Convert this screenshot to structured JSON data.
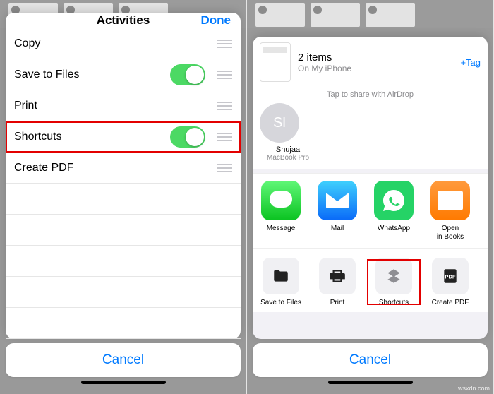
{
  "left": {
    "header_title": "Activities",
    "done_label": "Done",
    "cancel_label": "Cancel",
    "rows": [
      {
        "label": "Copy",
        "toggle": null
      },
      {
        "label": "Save to Files",
        "toggle": true
      },
      {
        "label": "Print",
        "toggle": null
      },
      {
        "label": "Shortcuts",
        "toggle": true,
        "highlight": true
      },
      {
        "label": "Create PDF",
        "toggle": null
      }
    ]
  },
  "right": {
    "item_title": "2 items",
    "item_subtitle": "On My iPhone",
    "tag_label": "+Tag",
    "airdrop_hint": "Tap to share with AirDrop",
    "airdrop_initials": "Sl",
    "airdrop_name": "Shujaa",
    "airdrop_device": "MacBook Pro",
    "apps": [
      {
        "label": "Message",
        "icon": "message"
      },
      {
        "label": "Mail",
        "icon": "mail"
      },
      {
        "label": "WhatsApp",
        "icon": "whatsapp"
      },
      {
        "label": "Open\nin Books",
        "icon": "books"
      }
    ],
    "actions": [
      {
        "label": "Save to Files",
        "icon": "folder"
      },
      {
        "label": "Print",
        "icon": "print"
      },
      {
        "label": "Shortcuts",
        "icon": "shortcuts",
        "highlight": true
      },
      {
        "label": "Create PDF",
        "icon": "pdf"
      }
    ],
    "cancel_label": "Cancel"
  },
  "watermark": "wsxdn.com"
}
